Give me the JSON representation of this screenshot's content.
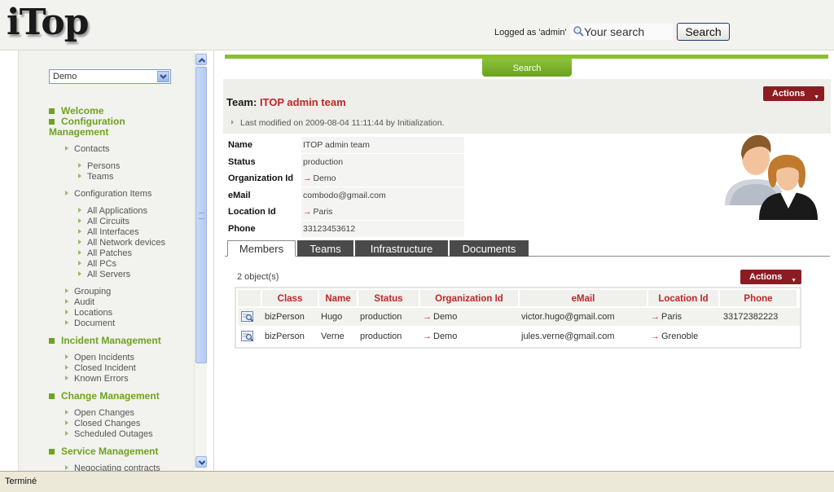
{
  "header": {
    "logo": "iTop",
    "logged_as": "Logged as 'admin'",
    "search_placeholder": "Your search",
    "search_button": "Search"
  },
  "sidebar": {
    "org_select_value": "Demo",
    "sections": [
      {
        "label": "Welcome"
      },
      {
        "label": "Configuration Management"
      },
      {
        "label": "Incident Management"
      },
      {
        "label": "Change Management"
      },
      {
        "label": "Service Management"
      }
    ],
    "config_items": {
      "contacts": "Contacts",
      "persons": "Persons",
      "teams": "Teams",
      "configuration_items": "Configuration Items",
      "all_applications": "All Applications",
      "all_circuits": "All Circuits",
      "all_interfaces": "All Interfaces",
      "all_network_devices": "All Network devices",
      "all_patches": "All Patches",
      "all_pcs": "All PCs",
      "all_servers": "All Servers",
      "grouping": "Grouping",
      "audit": "Audit",
      "locations": "Locations",
      "document": "Document"
    },
    "incident_items": [
      "Open Incidents",
      "Closed Incident",
      "Known Errors"
    ],
    "change_items": [
      "Open Changes",
      "Closed Changes",
      "Scheduled Outages"
    ],
    "service_items": [
      "Negociating contracts"
    ]
  },
  "main": {
    "search_tab": "Search",
    "title_prefix": "Team: ",
    "title_name": "ITOP admin team",
    "actions_label": "Actions",
    "last_modified": "Last modified on 2009-08-04 11:11:44 by Initialization.",
    "properties": [
      {
        "label": "Name",
        "value": "ITOP admin team"
      },
      {
        "label": "Status",
        "value": "production"
      },
      {
        "label": "Organization Id",
        "value": "Demo"
      },
      {
        "label": "eMail",
        "value": "combodo@gmail.com"
      },
      {
        "label": "Location Id",
        "value": "Paris"
      },
      {
        "label": "Phone",
        "value": "33123453612"
      }
    ],
    "tabs": [
      "Members",
      "Teams",
      "Infrastructure",
      "Documents"
    ],
    "object_count": "2 object(s)",
    "table": {
      "columns": [
        "Class",
        "Name",
        "Status",
        "Organization Id",
        "eMail",
        "Location Id",
        "Phone"
      ],
      "rows": [
        [
          "bizPerson",
          "Hugo",
          "production",
          "Demo",
          "victor.hugo@gmail.com",
          "Paris",
          "33172382223"
        ],
        [
          "bizPerson",
          "Verne",
          "production",
          "Demo",
          "jules.verne@gmail.com",
          "Grenoble",
          ""
        ]
      ]
    }
  },
  "status_bar": {
    "text": "Terminé"
  },
  "colors": {
    "accent_green": "#8abf28",
    "menu_green": "#6ea320",
    "title_red": "#c0262a",
    "actions_bg": "#8c1c22"
  }
}
